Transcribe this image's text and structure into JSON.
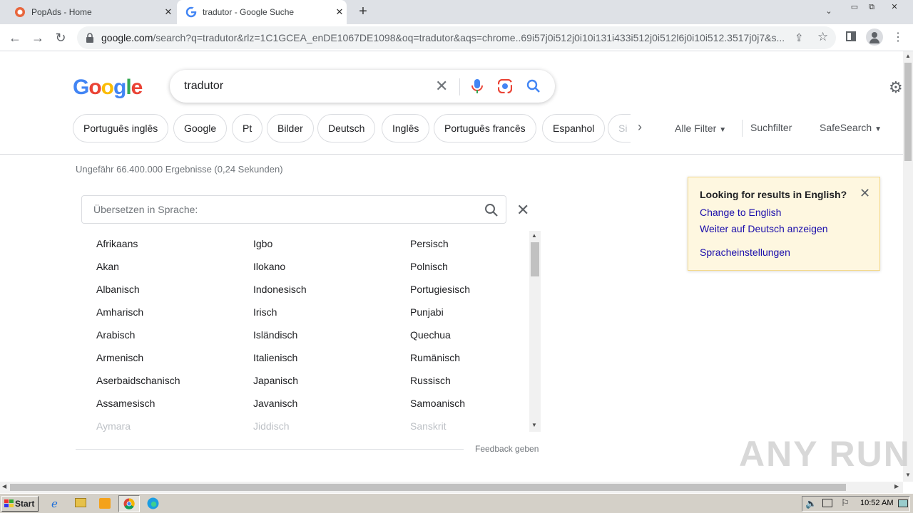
{
  "browser": {
    "tabs": [
      {
        "title": "PopAds - Home",
        "active": false
      },
      {
        "title": "tradutor - Google Suche",
        "active": true
      }
    ],
    "url_host": "google.com",
    "url_path": "/search?q=tradutor&rlz=1C1GCEA_enDE1067DE1098&oq=tradutor&aqs=chrome..69i57j0i512j0i10i131i433i512j0i512l6j0i10i512.3517j0j7&s..."
  },
  "google": {
    "logo": "Google",
    "query": "tradutor",
    "chips": [
      "Português inglês",
      "Google",
      "Pt",
      "Bilder",
      "Deutsch",
      "Inglês",
      "Português francês",
      "Espanhol",
      "Si"
    ],
    "all_filters": "Alle Filter",
    "search_filter": "Suchfilter",
    "safesearch": "SafeSearch",
    "stats": "Ungefähr 66.400.000 Ergebnisse (0,24 Sekunden)"
  },
  "translator": {
    "placeholder": "Übersetzen in Sprache:",
    "columns": [
      [
        "Afrikaans",
        "Akan",
        "Albanisch",
        "Amharisch",
        "Arabisch",
        "Armenisch",
        "Aserbaidschanisch",
        "Assamesisch",
        "Aymara"
      ],
      [
        "Igbo",
        "Ilokano",
        "Indonesisch",
        "Irisch",
        "Isländisch",
        "Italienisch",
        "Japanisch",
        "Javanisch",
        "Jiddisch"
      ],
      [
        "Persisch",
        "Polnisch",
        "Portugiesisch",
        "Punjabi",
        "Quechua",
        "Rumänisch",
        "Russisch",
        "Samoanisch",
        "Sanskrit"
      ]
    ],
    "feedback": "Feedback geben"
  },
  "notice": {
    "title": "Looking for results in English?",
    "change": "Change to English",
    "continue": "Weiter auf Deutsch anzeigen",
    "settings": "Spracheinstellungen"
  },
  "taskbar": {
    "start": "Start",
    "clock": "10:52 AM"
  },
  "watermark": "ANY RUN",
  "colors": {
    "link": "#1a0dab",
    "notice_bg": "#fef7e0",
    "accent": "#1a73e8"
  }
}
